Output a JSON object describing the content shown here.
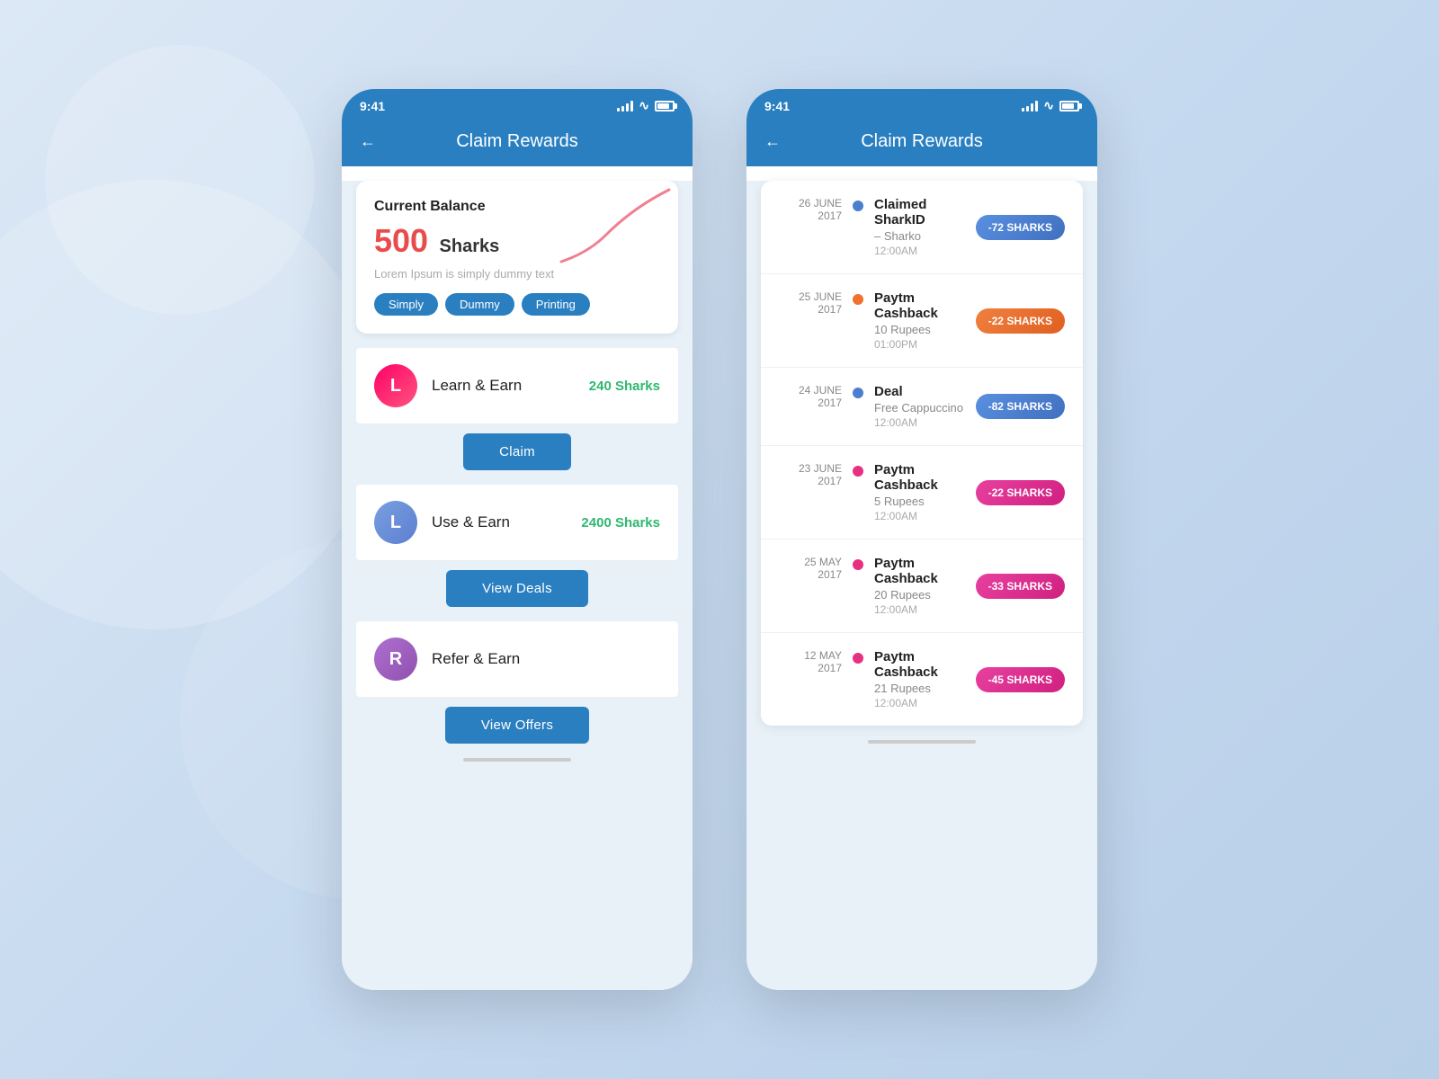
{
  "background": {
    "color": "#c5d9ef"
  },
  "phone1": {
    "statusBar": {
      "time": "9:41",
      "title": "Claim Rewards"
    },
    "balanceCard": {
      "title": "Current Balance",
      "amount": "500",
      "unit": "Sharks",
      "subtitle": "Lorem Ipsum is simply dummy text",
      "tags": [
        "Simply",
        "Dummy",
        "Printing"
      ]
    },
    "sections": [
      {
        "avatar": "L",
        "avatarColor": "pink",
        "label": "Learn & Earn",
        "value": "240 Sharks",
        "buttonLabel": "Claim"
      },
      {
        "avatar": "L",
        "avatarColor": "blue",
        "label": "Use & Earn",
        "value": "2400 Sharks",
        "buttonLabel": "View Deals"
      },
      {
        "avatar": "R",
        "avatarColor": "purple",
        "label": "Refer & Earn",
        "value": "",
        "buttonLabel": "View Offers"
      }
    ],
    "homeIndicatorColor": "#ccc"
  },
  "phone2": {
    "statusBar": {
      "time": "9:41",
      "title": "Claim Rewards"
    },
    "transactions": [
      {
        "dateDay": "26 JUNE",
        "dateYear": "2017",
        "dotColor": "blue",
        "title": "Claimed SharkID",
        "subtitle": "– Sharko",
        "time": "12:00AM",
        "badge": "-72 SHARKS",
        "badgeColor": "blue"
      },
      {
        "dateDay": "25 JUNE",
        "dateYear": "2017",
        "dotColor": "orange",
        "title": "Paytm Cashback",
        "subtitle": "10 Rupees",
        "time": "01:00PM",
        "badge": "-22 SHARKS",
        "badgeColor": "orange"
      },
      {
        "dateDay": "24 JUNE",
        "dateYear": "2017",
        "dotColor": "blue",
        "title": "Deal",
        "subtitle": "Free Cappuccino",
        "time": "12:00AM",
        "badge": "-82 SHARKS",
        "badgeColor": "blue"
      },
      {
        "dateDay": "23 JUNE",
        "dateYear": "2017",
        "dotColor": "pink",
        "title": "Paytm Cashback",
        "subtitle": "5 Rupees",
        "time": "12:00AM",
        "badge": "-22 SHARKS",
        "badgeColor": "pink"
      },
      {
        "dateDay": "25 MAY",
        "dateYear": "2017",
        "dotColor": "pink",
        "title": "Paytm Cashback",
        "subtitle": "20 Rupees",
        "time": "12:00AM",
        "badge": "-33 SHARKS",
        "badgeColor": "pink"
      },
      {
        "dateDay": "12 MAY",
        "dateYear": "2017",
        "dotColor": "pink",
        "title": "Paytm Cashback",
        "subtitle": "21 Rupees",
        "time": "12:00AM",
        "badge": "-45 SHARKS",
        "badgeColor": "pink"
      }
    ]
  }
}
